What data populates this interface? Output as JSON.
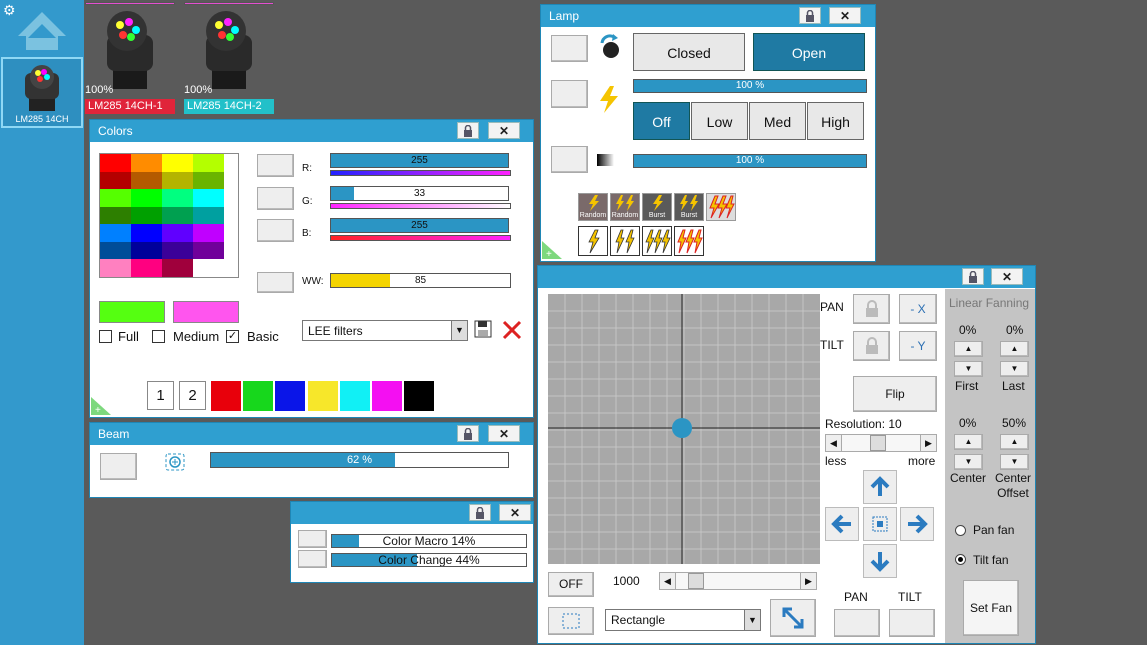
{
  "sidebar": {
    "fixture_label": "LM285 14CH"
  },
  "fixtures": [
    {
      "pct": "100%",
      "name": "LM285 14CH-1",
      "color": "#e0243a",
      "bar": "#e34fd0"
    },
    {
      "pct": "100%",
      "name": "LM285 14CH-2",
      "color": "#22c0c9",
      "bar": "#e34fd0"
    }
  ],
  "colors": {
    "title": "Colors",
    "r_label": "R:",
    "g_label": "G:",
    "b_label": "B:",
    "ww_label": "WW:",
    "r_value": "255",
    "g_value": "33",
    "b_value": "255",
    "ww_value": "85",
    "r_level": 1.0,
    "g_level": 0.13,
    "b_level": 1.0,
    "ww_level": 0.33,
    "full_label": "Full",
    "medium_label": "Medium",
    "basic_label": "Basic",
    "filter_select": "LEE filters",
    "page1": "1",
    "page2": "2",
    "quick_colors": [
      "#e8000b",
      "#17d71c",
      "#0a15e8",
      "#f7e72a",
      "#11f0f5",
      "#f40ff2",
      "#000000"
    ],
    "swatch1": "#55ff11",
    "swatch2": "#ff55ee",
    "grid": [
      [
        "#ff0000",
        "#ff8c00",
        "#ffff00",
        "#b4ff00"
      ],
      [
        "#b40000",
        "#b45a00",
        "#b4b400",
        "#6ab400"
      ],
      [
        "#55ff00",
        "#00ff00",
        "#00ff80",
        "#00ffff"
      ],
      [
        "#2d7f00",
        "#00a000",
        "#00a050",
        "#00a0a0"
      ],
      [
        "#0080ff",
        "#0000ff",
        "#6000ff",
        "#c000ff"
      ],
      [
        "#004d99",
        "#00009a",
        "#3b0099",
        "#70009a"
      ],
      [
        "#ff80c0",
        "#ff0080",
        "#a0003c",
        "#ffffff"
      ]
    ]
  },
  "beam": {
    "title": "Beam",
    "value": "62 %",
    "level": 0.62
  },
  "macro": {
    "color_macro": "Color Macro    14%",
    "color_change": "Color Change    44%",
    "macro_level": 0.14,
    "change_level": 0.44
  },
  "lamp": {
    "title": "Lamp",
    "closed": "Closed",
    "open": "Open",
    "dimmer": "100 %",
    "strobe": "100 %",
    "off": "Off",
    "low": "Low",
    "med": "Med",
    "high": "High",
    "strobe_buttons": [
      "Random",
      "Random",
      "Burst",
      "Burst"
    ]
  },
  "pantilt": {
    "pan": "PAN",
    "tilt": "TILT",
    "minus_x": "- X",
    "minus_y": "- Y",
    "flip": "Flip",
    "resolution": "Resolution: 10",
    "less": "less",
    "more": "more",
    "off": "OFF",
    "speed": "1000",
    "shape": "Rectangle",
    "pan_bottom": "PAN",
    "tilt_bottom": "TILT",
    "linear_fanning": "Linear Fanning",
    "first_pct": "0%",
    "last_pct": "0%",
    "center_pct": "0%",
    "offset_pct": "50%",
    "first": "First",
    "last": "Last",
    "center": "Center",
    "center_offset": "Center Offset",
    "pan_fan": "Pan fan",
    "tilt_fan": "Tilt fan",
    "set_fan": "Set Fan"
  }
}
